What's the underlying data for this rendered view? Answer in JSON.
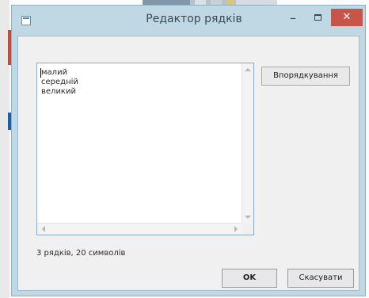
{
  "window": {
    "title": "Редактор рядків",
    "minimize_glyph": "–",
    "close_glyph": "✕"
  },
  "editor": {
    "lines": [
      "малий",
      "середній",
      "великий"
    ]
  },
  "buttons": {
    "sort_label": "Впорядкування",
    "ok_label": "OK",
    "cancel_label": "Скасувати"
  },
  "status": {
    "text": "3 рядків, 20 символів"
  },
  "colors": {
    "close_button": "#c8554a",
    "titlebar": "#bfd8e3",
    "textbox_border": "#8aa9c6"
  },
  "icons": {
    "app": "window-app-icon",
    "minimize": "minimize-icon",
    "maximize": "maximize-icon",
    "close": "close-icon"
  }
}
